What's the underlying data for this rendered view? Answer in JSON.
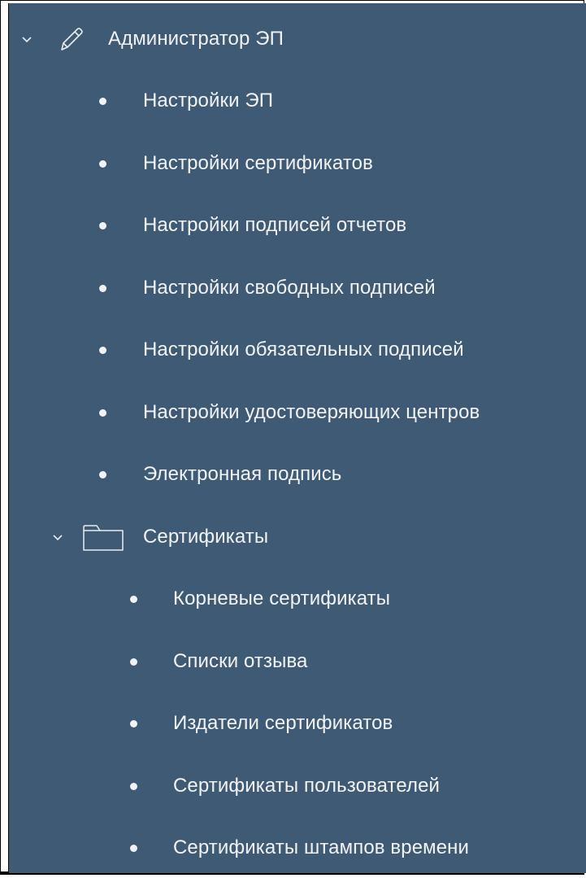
{
  "tree": {
    "root": {
      "label": "Администратор ЭП",
      "icon": "pencil-icon",
      "expanded": true,
      "children": [
        {
          "label": "Настройки ЭП"
        },
        {
          "label": "Настройки сертификатов"
        },
        {
          "label": "Настройки подписей отчетов"
        },
        {
          "label": "Настройки свободных подписей"
        },
        {
          "label": "Настройки обязательных подписей"
        },
        {
          "label": "Настройки удостоверяющих центров"
        },
        {
          "label": "Электронная подпись"
        }
      ],
      "folder": {
        "label": "Сертификаты",
        "icon": "folder-icon",
        "expanded": true,
        "children": [
          {
            "label": "Корневые сертификаты"
          },
          {
            "label": "Списки отзыва"
          },
          {
            "label": "Издатели сертификатов"
          },
          {
            "label": "Сертификаты пользователей"
          },
          {
            "label": "Сертификаты штампов времени"
          }
        ]
      }
    }
  },
  "colors": {
    "panel_background": "#3f5a75",
    "text": "#f1f3f5"
  }
}
